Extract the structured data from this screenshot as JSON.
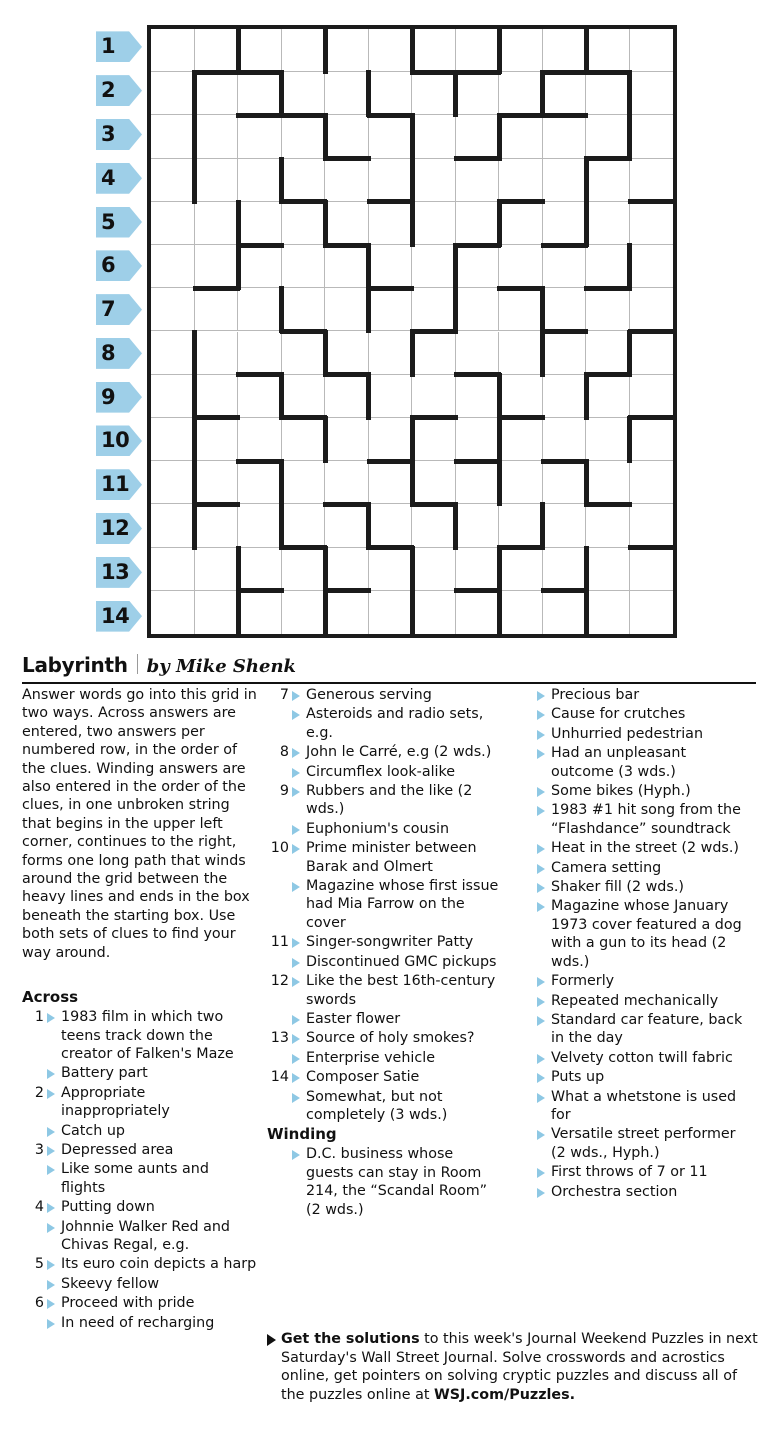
{
  "header": {
    "title": "Labyrinth",
    "byline": "by Mike Shenk"
  },
  "grid": {
    "columns": 12,
    "rows": 14,
    "row_labels": [
      "1",
      "2",
      "3",
      "4",
      "5",
      "6",
      "7",
      "8",
      "9",
      "10",
      "11",
      "12",
      "13",
      "14"
    ],
    "accent_tab_color": "#9ecfe8",
    "heavy_line_color": "#1b1b1b",
    "thin_line_color": "#b9b9b9"
  },
  "instructions": "Answer words go into this grid in two ways. Across answers are entered, two answers per numbered row, in the order of the clues. Winding answers are also entered in the order of the clues, in one unbroken string that begins in the upper left corner, continues to the right, forms one long path that winds around the grid between the heavy lines and ends in the box beneath the starting box. Use both sets of clues to find your way around.",
  "across": {
    "heading": "Across",
    "clues": [
      {
        "num": "1",
        "text": "1983 film in which two teens track down the creator of Falken's Maze"
      },
      {
        "num": "",
        "text": "Battery part"
      },
      {
        "num": "2",
        "text": "Appropriate inappropriately"
      },
      {
        "num": "",
        "text": "Catch up"
      },
      {
        "num": "3",
        "text": "Depressed area"
      },
      {
        "num": "",
        "text": "Like some aunts and flights"
      },
      {
        "num": "4",
        "text": "Putting down"
      },
      {
        "num": "",
        "text": "Johnnie Walker Red and Chivas Regal, e.g."
      },
      {
        "num": "5",
        "text": "Its euro coin depicts a harp"
      },
      {
        "num": "",
        "text": "Skeevy fellow"
      },
      {
        "num": "6",
        "text": "Proceed with pride"
      },
      {
        "num": "",
        "text": "In need of recharging"
      },
      {
        "num": "7",
        "text": "Generous serving"
      },
      {
        "num": "",
        "text": "Asteroids and radio sets, e.g."
      },
      {
        "num": "8",
        "text": "John le Carré, e.g (2 wds.)"
      },
      {
        "num": "",
        "text": "Circumflex look-alike"
      },
      {
        "num": "9",
        "text": "Rubbers and the like (2 wds.)"
      },
      {
        "num": "",
        "text": "Euphonium's cousin"
      },
      {
        "num": "10",
        "text": "Prime minister between Barak and Olmert"
      },
      {
        "num": "",
        "text": "Magazine whose first issue had Mia Farrow on the cover"
      },
      {
        "num": "11",
        "text": "Singer-songwriter Patty"
      },
      {
        "num": "",
        "text": "Discontinued GMC pickups"
      },
      {
        "num": "12",
        "text": "Like the best 16th-century swords"
      },
      {
        "num": "",
        "text": "Easter flower"
      },
      {
        "num": "13",
        "text": "Source of holy smokes?"
      },
      {
        "num": "",
        "text": "Enterprise vehicle"
      },
      {
        "num": "14",
        "text": "Composer Satie"
      },
      {
        "num": "",
        "text": "Somewhat, but not completely (3 wds.)"
      }
    ]
  },
  "winding": {
    "heading": "Winding",
    "clues": [
      {
        "text": "D.C. business whose guests can stay in Room 214, the “Scandal Room” (2 wds.)"
      },
      {
        "text": "Precious bar"
      },
      {
        "text": "Cause for crutches"
      },
      {
        "text": "Unhurried pedestrian"
      },
      {
        "text": "Had an unpleasant outcome (3 wds.)"
      },
      {
        "text": "Some bikes (Hyph.)"
      },
      {
        "text": "1983 #1 hit song from the “Flashdance” soundtrack"
      },
      {
        "text": "Heat in the street (2 wds.)"
      },
      {
        "text": "Camera setting"
      },
      {
        "text": "Shaker fill (2 wds.)"
      },
      {
        "text": "Magazine whose January 1973 cover featured a dog with a gun to its head (2 wds.)"
      },
      {
        "text": "Formerly"
      },
      {
        "text": "Repeated mechanically"
      },
      {
        "text": "Standard car feature, back in the day"
      },
      {
        "text": "Velvety cotton twill fabric"
      },
      {
        "text": "Puts up"
      },
      {
        "text": "What a whetstone is used for"
      },
      {
        "text": "Versatile street performer (2 wds., Hyph.)"
      },
      {
        "text": "First throws of 7 or 11"
      },
      {
        "text": "Orchestra section"
      }
    ]
  },
  "footer": {
    "lead": "Get the solutions",
    "body": " to this week's Journal Weekend Puzzles in next Saturday's Wall Street Journal. Solve crosswords and acrostics online, get pointers on solving cryptic puzzles and discuss all of the puzzles online at ",
    "link": "WSJ.com/Puzzles."
  },
  "walls": {
    "vertical": [
      [
        0,
        2
      ],
      [
        0,
        4
      ],
      [
        0,
        6
      ],
      [
        0,
        8
      ],
      [
        0,
        10
      ],
      [
        1,
        1
      ],
      [
        1,
        3
      ],
      [
        1,
        5
      ],
      [
        1,
        7
      ],
      [
        1,
        9
      ],
      [
        1,
        11
      ],
      [
        2,
        1
      ],
      [
        2,
        4
      ],
      [
        2,
        6
      ],
      [
        2,
        8
      ],
      [
        2,
        11
      ],
      [
        3,
        1
      ],
      [
        3,
        3
      ],
      [
        3,
        6
      ],
      [
        3,
        10
      ],
      [
        4,
        2
      ],
      [
        4,
        4
      ],
      [
        4,
        6
      ],
      [
        4,
        8
      ],
      [
        4,
        10
      ],
      [
        5,
        2
      ],
      [
        5,
        5
      ],
      [
        5,
        7
      ],
      [
        5,
        11
      ],
      [
        6,
        3
      ],
      [
        6,
        5
      ],
      [
        6,
        7
      ],
      [
        6,
        9
      ],
      [
        7,
        1
      ],
      [
        7,
        4
      ],
      [
        7,
        6
      ],
      [
        7,
        9
      ],
      [
        7,
        11
      ],
      [
        8,
        1
      ],
      [
        8,
        3
      ],
      [
        8,
        5
      ],
      [
        8,
        8
      ],
      [
        8,
        10
      ],
      [
        9,
        1
      ],
      [
        9,
        4
      ],
      [
        9,
        6
      ],
      [
        9,
        8
      ],
      [
        9,
        11
      ],
      [
        10,
        1
      ],
      [
        10,
        3
      ],
      [
        10,
        6
      ],
      [
        10,
        8
      ],
      [
        10,
        10
      ],
      [
        11,
        1
      ],
      [
        11,
        3
      ],
      [
        11,
        5
      ],
      [
        11,
        7
      ],
      [
        11,
        9
      ],
      [
        12,
        2
      ],
      [
        12,
        4
      ],
      [
        12,
        6
      ],
      [
        12,
        8
      ],
      [
        12,
        10
      ],
      [
        13,
        2
      ],
      [
        13,
        4
      ],
      [
        13,
        6
      ],
      [
        13,
        8
      ],
      [
        13,
        10
      ]
    ],
    "horizontal": [
      [
        1,
        1
      ],
      [
        1,
        2
      ],
      [
        1,
        6
      ],
      [
        1,
        7
      ],
      [
        1,
        9
      ],
      [
        1,
        10
      ],
      [
        2,
        2
      ],
      [
        2,
        3
      ],
      [
        2,
        5
      ],
      [
        2,
        8
      ],
      [
        2,
        9
      ],
      [
        3,
        4
      ],
      [
        3,
        7
      ],
      [
        3,
        10
      ],
      [
        4,
        3
      ],
      [
        4,
        5
      ],
      [
        4,
        8
      ],
      [
        4,
        11
      ],
      [
        5,
        2
      ],
      [
        5,
        4
      ],
      [
        5,
        7
      ],
      [
        5,
        9
      ],
      [
        6,
        1
      ],
      [
        6,
        5
      ],
      [
        6,
        8
      ],
      [
        6,
        10
      ],
      [
        7,
        3
      ],
      [
        7,
        6
      ],
      [
        7,
        9
      ],
      [
        7,
        11
      ],
      [
        8,
        2
      ],
      [
        8,
        4
      ],
      [
        8,
        7
      ],
      [
        8,
        10
      ],
      [
        9,
        1
      ],
      [
        9,
        3
      ],
      [
        9,
        6
      ],
      [
        9,
        8
      ],
      [
        9,
        11
      ],
      [
        10,
        2
      ],
      [
        10,
        5
      ],
      [
        10,
        7
      ],
      [
        10,
        9
      ],
      [
        11,
        1
      ],
      [
        11,
        4
      ],
      [
        11,
        6
      ],
      [
        11,
        10
      ],
      [
        12,
        3
      ],
      [
        12,
        5
      ],
      [
        12,
        8
      ],
      [
        12,
        11
      ],
      [
        13,
        2
      ],
      [
        13,
        4
      ],
      [
        13,
        7
      ],
      [
        13,
        9
      ]
    ]
  }
}
